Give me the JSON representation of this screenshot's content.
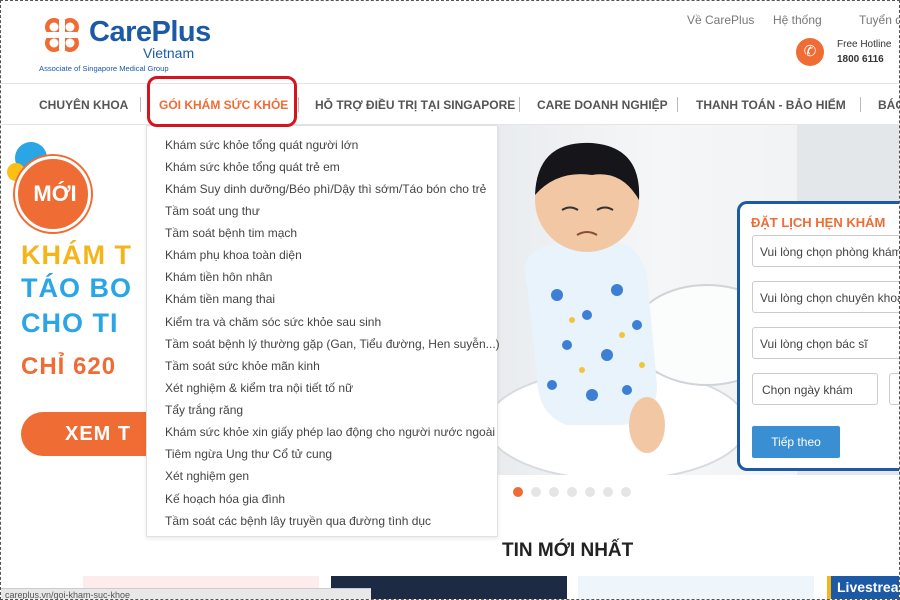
{
  "brand": {
    "name": "CarePlus",
    "country": "Vietnam",
    "tagline": "Associate of Singapore Medical Group"
  },
  "top_links": [
    "Về CarePlus",
    "Hệ thống",
    "Tuyển d"
  ],
  "hotline": {
    "label": "Free Hotline",
    "number": "1800 6116",
    "icon": "phone-icon"
  },
  "nav": {
    "items": [
      "CHUYÊN KHOA",
      "GÓI KHÁM SỨC KHỎE",
      "HỖ TRỢ ĐIỀU TRỊ TẠI SINGAPORE",
      "CARE DOANH NGHIỆP",
      "THANH TOÁN - BẢO HIỂM",
      "BÁO"
    ],
    "active_index": 1
  },
  "dropdown": [
    "Khám sức khỏe tổng quát người lớn",
    "Khám sức khỏe tổng quát trẻ em",
    "Khám Suy dinh dưỡng/Béo phì/Dậy thì sớm/Táo bón cho trẻ",
    "Tầm soát ung thư",
    "Tầm soát bệnh tim mạch",
    "Khám phụ khoa toàn diện",
    "Khám tiền hôn nhân",
    "Khám tiền mang thai",
    "Kiểm tra và chăm sóc sức khỏe sau sinh",
    "Tầm soát bệnh lý thường gặp (Gan, Tiểu đường, Hen suyễn...)",
    "Tầm soát sức khỏe mãn kinh",
    "Xét nghiệm & kiểm tra nội tiết tố nữ",
    "Tẩy trắng răng",
    "Khám sức khỏe xin giấy phép lao động cho người nước ngoài",
    "Tiêm ngừa Ung thư Cổ tử cung",
    "Xét nghiệm gen",
    "Kế hoạch hóa gia đình",
    "Tầm soát các bệnh lây truyền qua đường tình dục"
  ],
  "hero": {
    "badge": "MỚI",
    "line1": "KHÁM T",
    "line2": "TÁO BO",
    "line3": "CHO TI",
    "price": "CHỈ 620",
    "cta": "XEM T"
  },
  "carousel": {
    "count": 7,
    "active": 0
  },
  "booking": {
    "title": "ĐẶT LỊCH HẸN KHÁM",
    "clinic_placeholder": "Vui lòng chọn phòng khám",
    "specialty_placeholder": "Vui lòng chọn chuyên khoa",
    "doctor_placeholder": "Vui lòng chọn bác sĩ",
    "date_placeholder": "Chọn ngày khám",
    "submit": "Tiếp theo"
  },
  "news": {
    "title": "TIN MỚI NHẤT",
    "livestream": "Livestrea"
  },
  "status_bar": "careplus.vn/goi-kham-suc-khoe",
  "colors": {
    "brand_blue": "#1c5aa6",
    "accent_orange": "#ef6c35",
    "highlight_red": "#d6141e",
    "promo_blue": "#2aa5e6",
    "promo_yellow": "#f5b51a"
  }
}
